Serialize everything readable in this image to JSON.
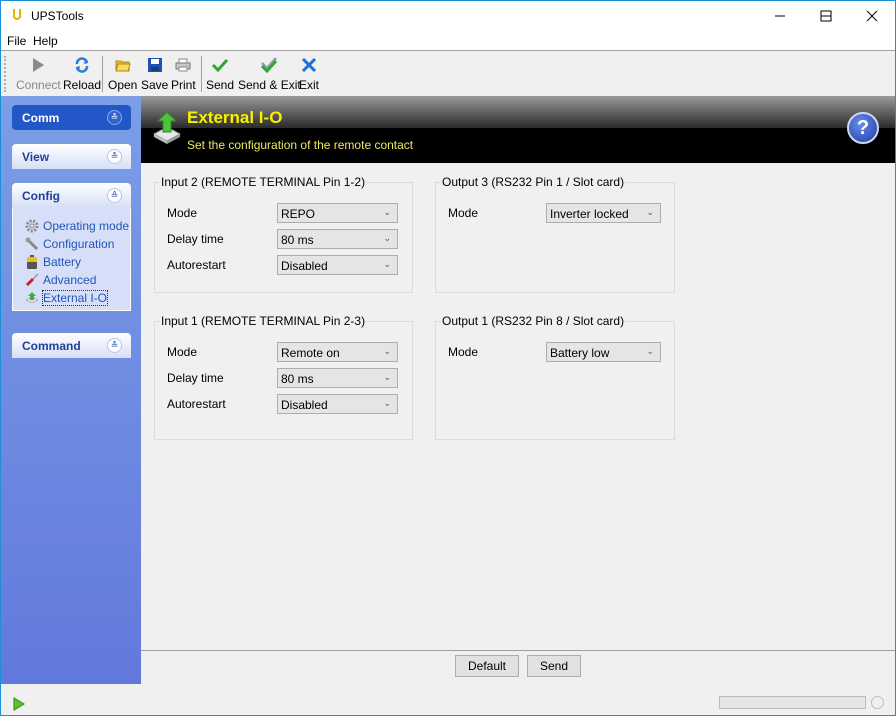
{
  "window": {
    "title": "UPSTools",
    "controls": {
      "minimize": "minimize",
      "maximize": "maximize",
      "close": "close"
    }
  },
  "menu": {
    "items": [
      "File",
      "Help"
    ]
  },
  "toolbar": {
    "buttons": [
      {
        "label": "Connect",
        "icon": "play-icon",
        "enabled": false
      },
      {
        "label": "Reload",
        "icon": "refresh-icon",
        "enabled": true
      },
      {
        "label": "Open",
        "icon": "folder-icon",
        "enabled": true
      },
      {
        "label": "Save",
        "icon": "floppy-icon",
        "enabled": true
      },
      {
        "label": "Print",
        "icon": "printer-icon",
        "enabled": true
      },
      {
        "label": "Send",
        "icon": "check-icon",
        "enabled": true
      },
      {
        "label": "Send & Exit",
        "icon": "double-check-icon",
        "enabled": true
      },
      {
        "label": "Exit",
        "icon": "x-icon",
        "enabled": true
      }
    ]
  },
  "sidebar": {
    "groups": [
      {
        "label": "Comm",
        "expanded": false,
        "highlighted": true
      },
      {
        "label": "View",
        "expanded": false
      },
      {
        "label": "Config",
        "expanded": true,
        "items": [
          {
            "label": "Operating mode",
            "icon": "gear-icon"
          },
          {
            "label": "Configuration",
            "icon": "wrench-icon"
          },
          {
            "label": "Battery",
            "icon": "battery-icon"
          },
          {
            "label": "Advanced",
            "icon": "screwdriver-icon"
          },
          {
            "label": "External I-O",
            "icon": "external-io-icon",
            "selected": true
          }
        ]
      },
      {
        "label": "Command",
        "expanded": false
      }
    ]
  },
  "banner": {
    "title": "External I-O",
    "subtitle": "Set the configuration of the remote contact",
    "help": "?"
  },
  "groups": {
    "input2": {
      "title": "Input 2 (REMOTE TERMINAL Pin 1-2)",
      "rows": [
        {
          "label": "Mode",
          "value": "REPO"
        },
        {
          "label": "Delay time",
          "value": "80 ms"
        },
        {
          "label": "Autorestart",
          "value": "Disabled"
        }
      ]
    },
    "output3": {
      "title": "Output 3 (RS232 Pin 1 / Slot card)",
      "rows": [
        {
          "label": "Mode",
          "value": "Inverter locked"
        }
      ]
    },
    "input1": {
      "title": "Input 1 (REMOTE TERMINAL Pin 2-3)",
      "rows": [
        {
          "label": "Mode",
          "value": "Remote on"
        },
        {
          "label": "Delay time",
          "value": "80 ms"
        },
        {
          "label": "Autorestart",
          "value": "Disabled"
        }
      ]
    },
    "output1": {
      "title": "Output 1 (RS232 Pin 8 / Slot card)",
      "rows": [
        {
          "label": "Mode",
          "value": "Battery low"
        }
      ]
    }
  },
  "footer": {
    "default_label": "Default",
    "send_label": "Send"
  },
  "status": {
    "progress": 0
  }
}
